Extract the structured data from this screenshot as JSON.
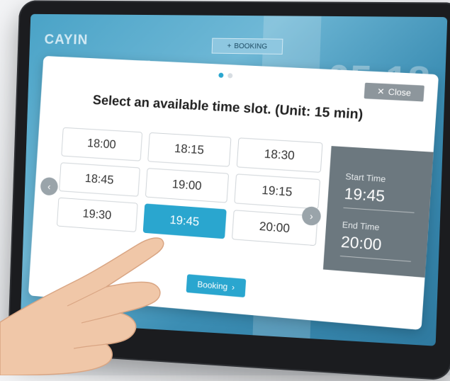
{
  "app": {
    "logo": "CAYIN",
    "booking_top_label": "BOOKING",
    "booking_top_icon": "plus-icon",
    "background_clock": "05:18"
  },
  "modal": {
    "pager": {
      "pages": 2,
      "current": 1
    },
    "close_label": "Close",
    "close_icon": "close-icon",
    "title": "Select an available time slot. (Unit: 15 min)",
    "slots": [
      {
        "label": "18:00",
        "selected": false
      },
      {
        "label": "18:15",
        "selected": false
      },
      {
        "label": "18:30",
        "selected": false
      },
      {
        "label": "18:45",
        "selected": false
      },
      {
        "label": "19:00",
        "selected": false
      },
      {
        "label": "19:15",
        "selected": false
      },
      {
        "label": "19:30",
        "selected": false
      },
      {
        "label": "19:45",
        "selected": true
      },
      {
        "label": "20:00",
        "selected": false
      }
    ],
    "prev_icon": "chevron-left-icon",
    "next_icon": "chevron-right-icon",
    "summary": {
      "start_label": "Start Time",
      "start_value": "19:45",
      "end_label": "End Time",
      "end_value": "20:00"
    },
    "booking_label": "Booking",
    "booking_icon": "chevron-right-icon"
  },
  "colors": {
    "accent": "#2aa6cf",
    "summary_panel": "#6c787f",
    "close_button": "#8d969c",
    "screen_bg": "#4aa3c7",
    "bezel": "#1b1c1f"
  }
}
